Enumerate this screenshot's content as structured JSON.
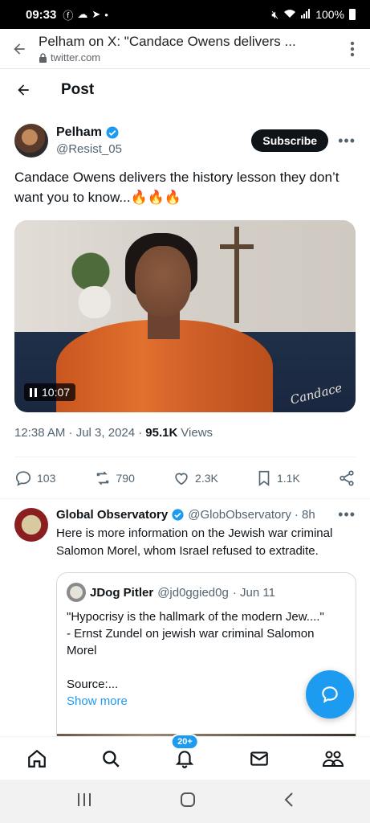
{
  "status_bar": {
    "time": "09:33",
    "battery": "100%"
  },
  "browser": {
    "title": "Pelham on X: \"Candace Owens delivers ...",
    "url": "twitter.com"
  },
  "header": {
    "title": "Post"
  },
  "tweet": {
    "author_name": "Pelham",
    "handle": "@Resist_05",
    "subscribe_label": "Subscribe",
    "text": "Candace Owens delivers the history lesson they don’t want you to know...🔥🔥🔥",
    "media": {
      "duration": "10:07",
      "signature": "Candace"
    },
    "time": "12:38 AM · Jul 3, 2024 ·",
    "views_count": "95.1K",
    "views_label": "Views",
    "stats": {
      "replies": "103",
      "reposts": "790",
      "likes": "2.3K",
      "bookmarks": "1.1K"
    }
  },
  "reply": {
    "name": "Global Observatory",
    "handle": "@GlobObservatory",
    "time": "· 8h",
    "text": "Here is more information on the Jewish war criminal Salomon Morel, whom Israel refused to extradite.",
    "quote": {
      "name": "JDog Pitler",
      "handle": "@jd0ggied0g",
      "time": "· Jun 11",
      "text": "\"Hypocrisy is the hallmark of the modern Jew....\"\n- Ernst Zundel on jewish war criminal Salomon Morel\n\nSource:...",
      "show_more": "Show more"
    }
  },
  "bottom_nav": {
    "notifications_badge": "20+"
  },
  "colors": {
    "accent": "#1d9bf0",
    "text": "#0f1419",
    "muted": "#536471"
  }
}
